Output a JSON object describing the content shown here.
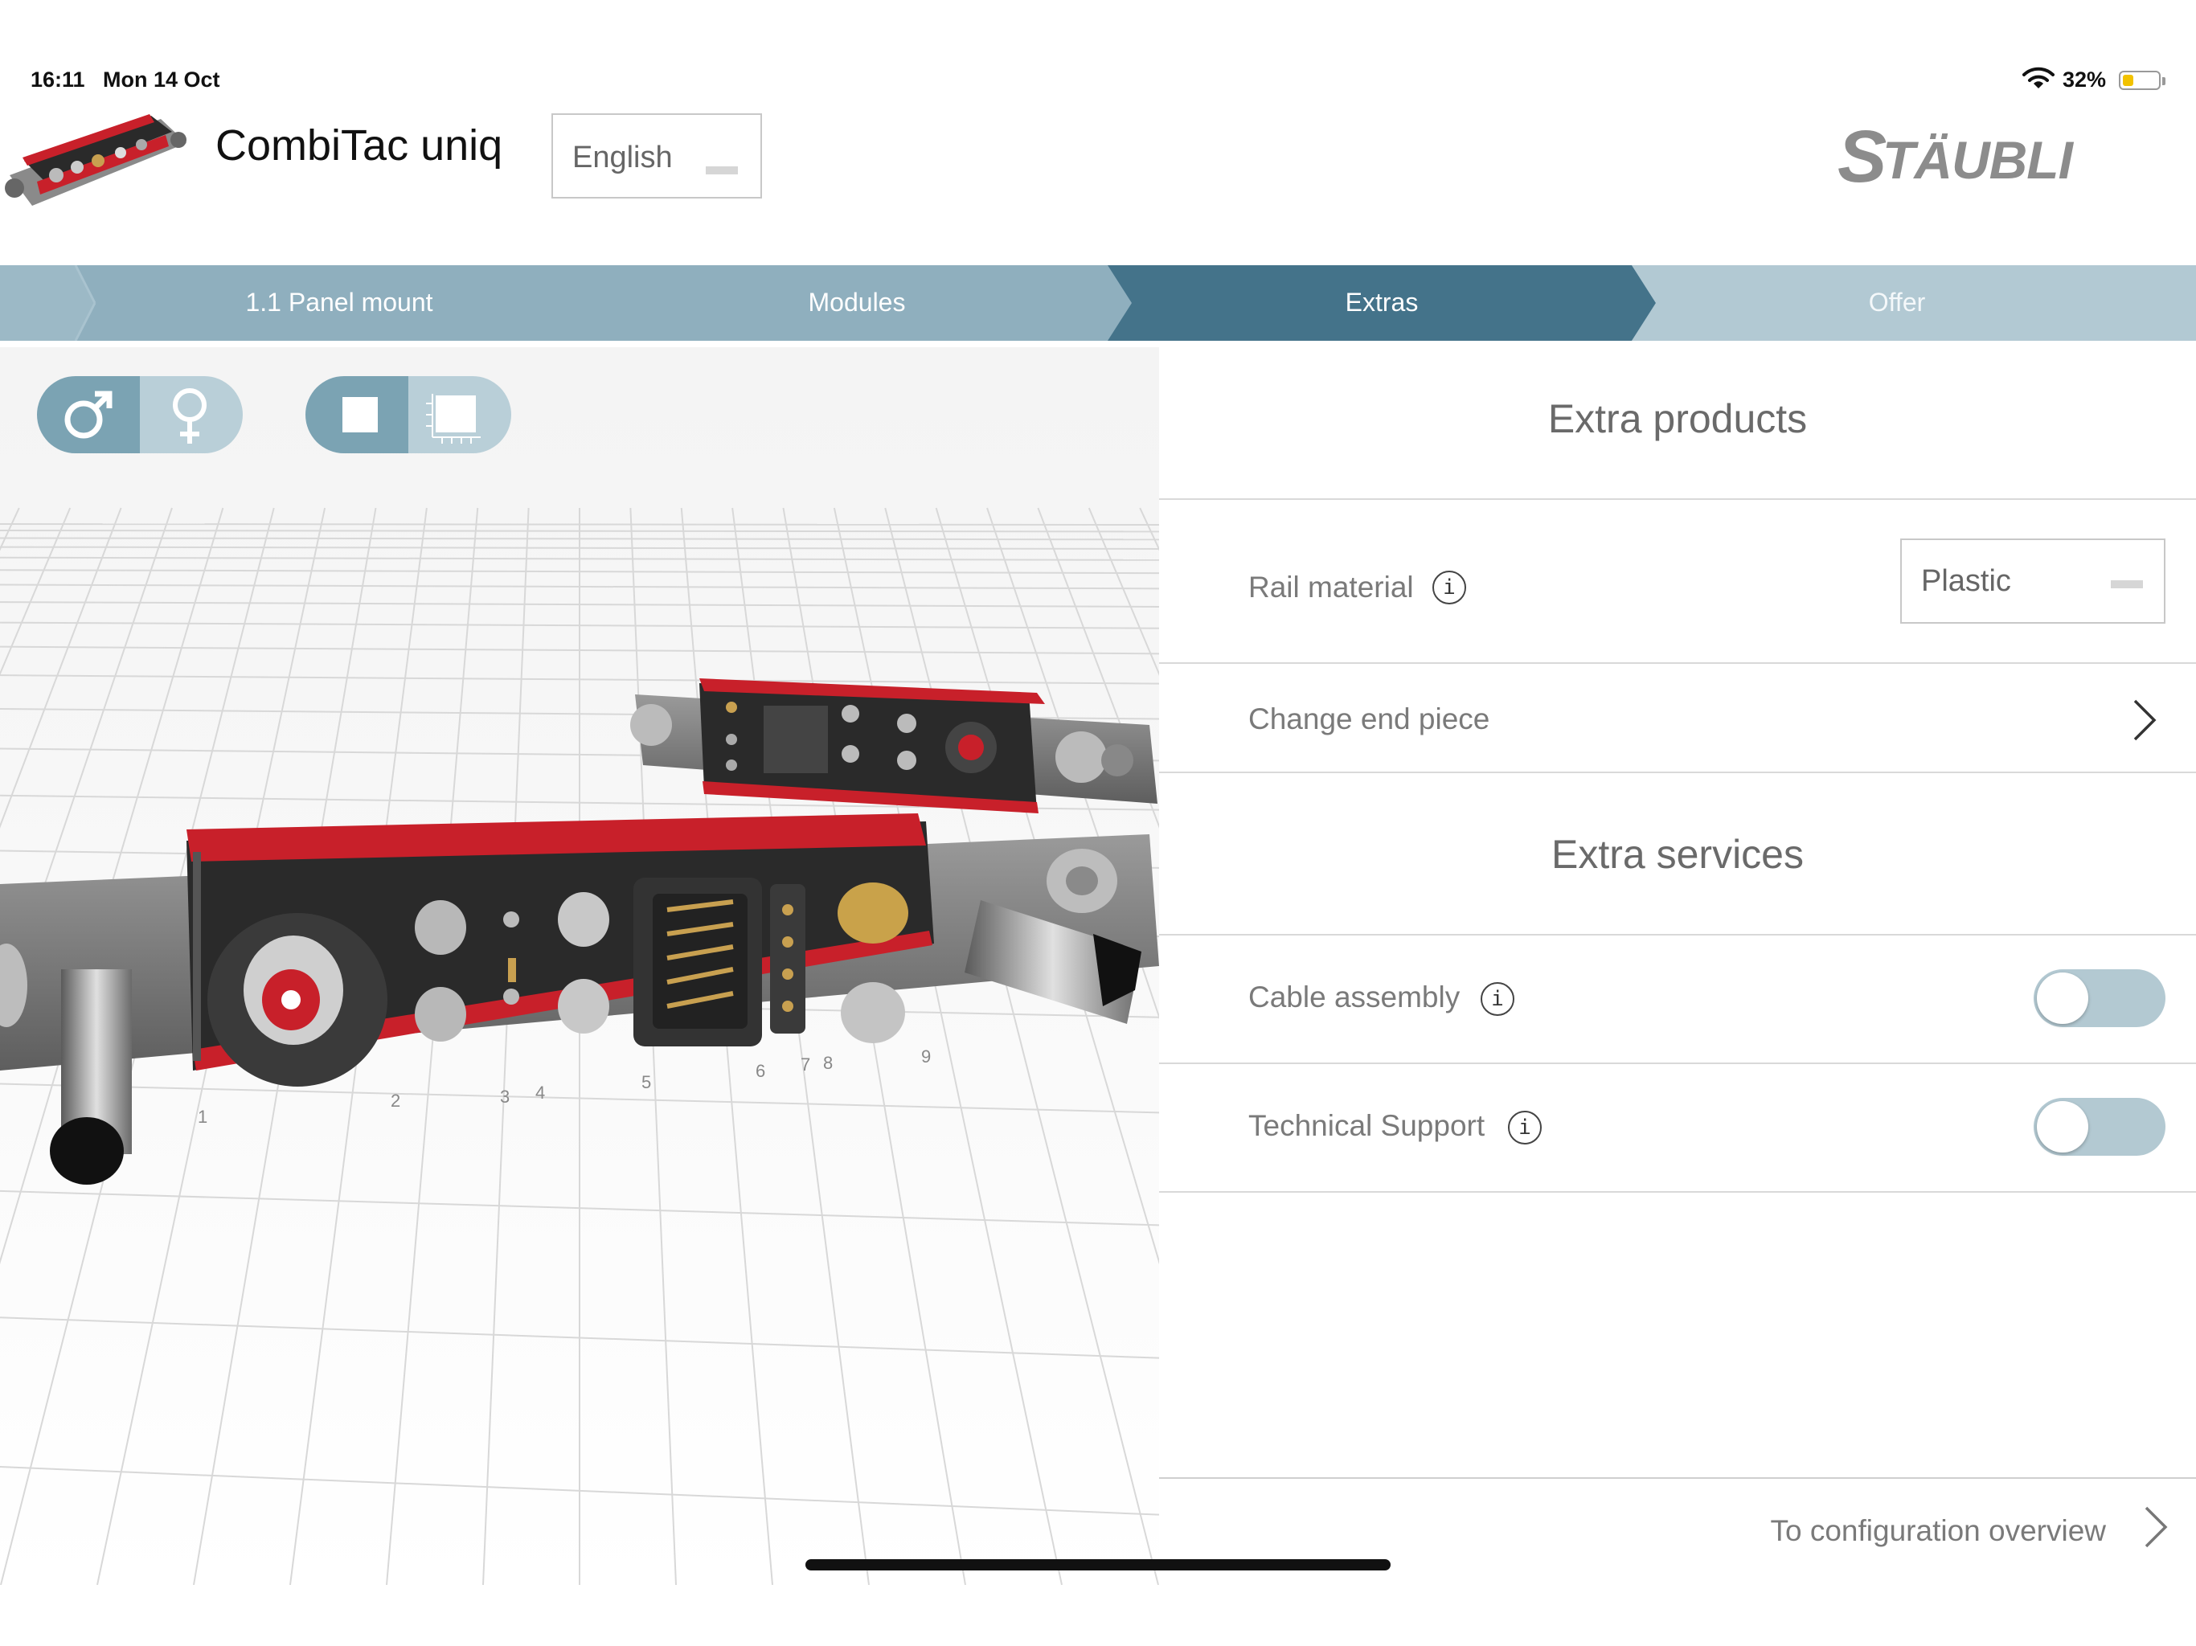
{
  "status": {
    "time": "16:11",
    "date": "Mon 14 Oct",
    "battery": "32%",
    "battery_level": 0.32
  },
  "header": {
    "title": "CombiTac uniq",
    "language": "English",
    "logo_text": "STÄUBLI"
  },
  "steps": [
    {
      "label": "1.1 Panel mount",
      "state": "done"
    },
    {
      "label": "Modules",
      "state": "done"
    },
    {
      "label": "Extras",
      "state": "active"
    },
    {
      "label": "Offer",
      "state": "pending"
    }
  ],
  "viewport": {
    "axis_numbers_front": [
      "1",
      "2",
      "3",
      "4",
      "5",
      "6",
      "7",
      "8",
      "9"
    ],
    "gender_toggle": {
      "selected": "male"
    },
    "view_toggle": {
      "selected": "solid"
    }
  },
  "panel": {
    "extra_products_title": "Extra products",
    "rail_material_label": "Rail material",
    "rail_material_value": "Plastic",
    "change_end_piece_label": "Change end piece",
    "extra_services_title": "Extra services",
    "cable_assembly_label": "Cable assembly",
    "cable_assembly_on": false,
    "technical_support_label": "Technical Support",
    "technical_support_on": false,
    "footer_link": "To configuration overview"
  },
  "colors": {
    "step_done": "#8fafbe",
    "step_active": "#44738a",
    "step_pending": "#b2c9d3",
    "accent_red": "#c8202a"
  }
}
